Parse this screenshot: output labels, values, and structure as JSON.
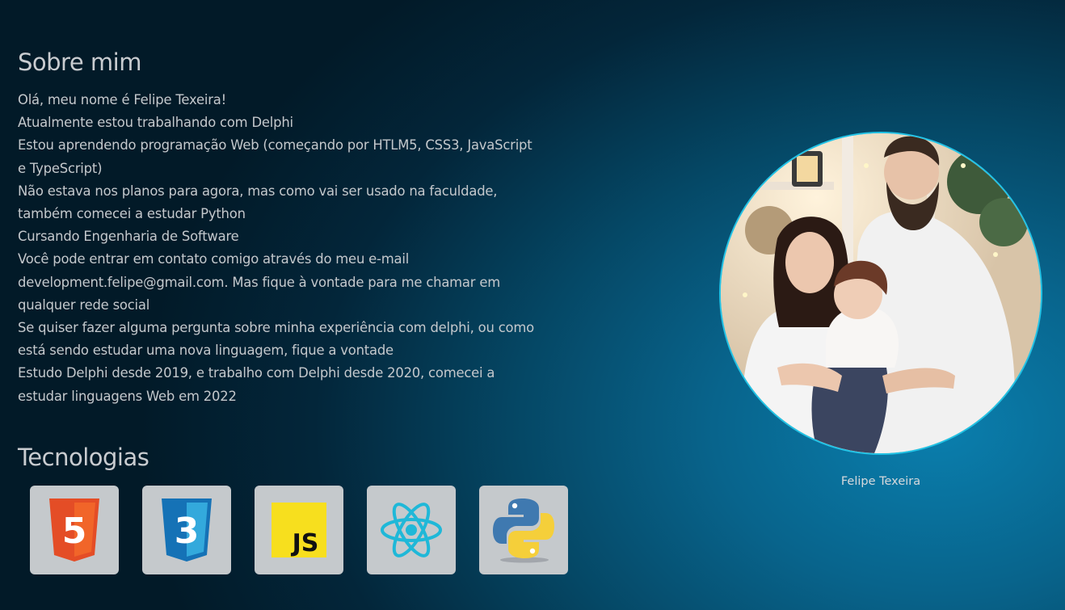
{
  "about": {
    "title": "Sobre mim",
    "lines": [
      "Olá, meu nome é Felipe Texeira!",
      "Atualmente estou trabalhando com Delphi",
      "Estou aprendendo programação Web (começando por HTLM5, CSS3, JavaScript",
      "e TypeScript)",
      "Não estava nos planos para agora, mas como vai ser usado na faculdade,",
      "também comecei a estudar Python",
      "Cursando Engenharia de Software",
      "Você pode entrar em contato comigo através do meu e-mail",
      "development.felipe@gmail.com. Mas fique à vontade para me chamar em",
      "qualquer rede social",
      "Se quiser fazer alguma pergunta sobre minha experiência com delphi, ou como",
      "está sendo estudar uma nova linguagem, fique a vontade",
      "Estudo Delphi desde 2019, e trabalho com Delphi desde 2020, comecei a",
      "estudar linguagens Web em 2022"
    ]
  },
  "technologies": {
    "title": "Tecnologias",
    "items": [
      {
        "icon": "html5-icon",
        "label": "5",
        "color": "#e44d26"
      },
      {
        "icon": "css3-icon",
        "label": "3",
        "color": "#1572b6"
      },
      {
        "icon": "javascript-icon",
        "label": "JS",
        "color": "#f7df1e"
      },
      {
        "icon": "react-icon",
        "color": "#1fb8d8"
      },
      {
        "icon": "python-icon",
        "color": "#3776ab"
      }
    ]
  },
  "profile": {
    "caption": "Felipe Texeira",
    "border_color": "#22c3e6"
  }
}
